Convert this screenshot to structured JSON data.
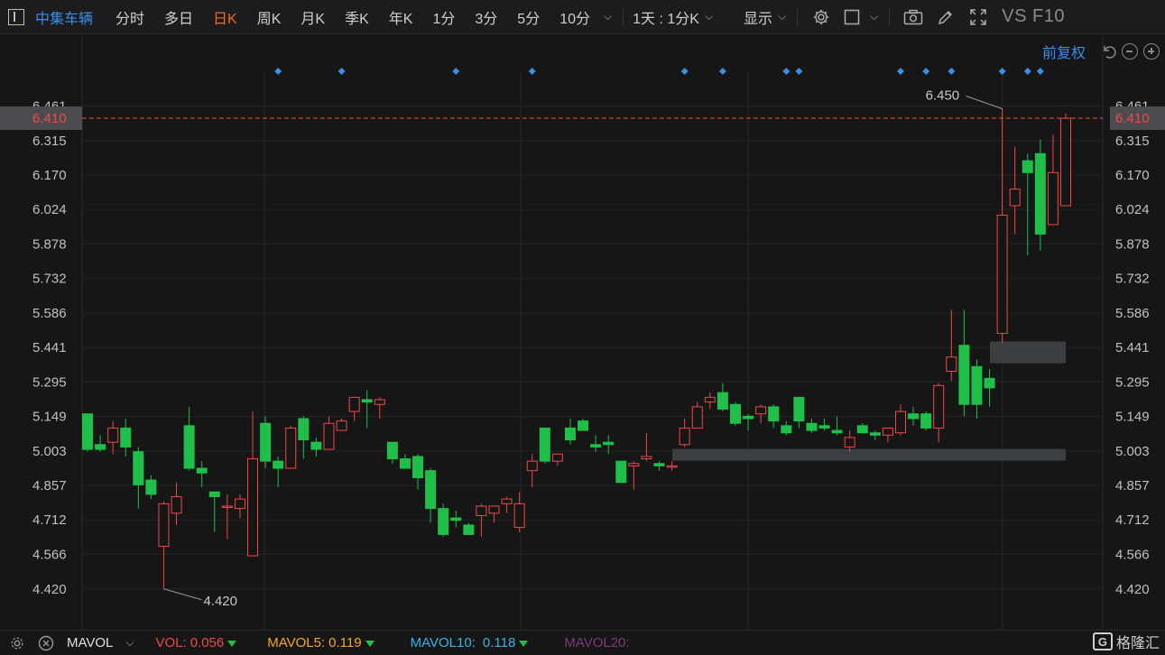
{
  "toolbar": {
    "stock_name": "中集车辆",
    "tabs": [
      {
        "label": "分时",
        "active": false
      },
      {
        "label": "多日",
        "active": false
      },
      {
        "label": "日K",
        "active": true
      },
      {
        "label": "周K",
        "active": false
      },
      {
        "label": "月K",
        "active": false
      },
      {
        "label": "季K",
        "active": false
      },
      {
        "label": "年K",
        "active": false
      },
      {
        "label": "1分",
        "active": false
      },
      {
        "label": "3分",
        "active": false
      },
      {
        "label": "5分",
        "active": false
      },
      {
        "label": "10分",
        "active": false
      }
    ],
    "period_select": "1天 : 1分K",
    "display_label": "显示",
    "vs_f10": "VS F10"
  },
  "chart_header": {
    "adjust_label": "前复权"
  },
  "price_axis": {
    "ticks": [
      "6.461",
      "6.315",
      "6.170",
      "6.024",
      "5.878",
      "5.732",
      "5.586",
      "5.441",
      "5.295",
      "5.149",
      "5.003",
      "4.857",
      "4.712",
      "4.566",
      "4.420"
    ],
    "current_price": "6.410",
    "high_annotation": "6.450",
    "low_annotation": "4.420"
  },
  "indicator_bar": {
    "name": "MAVOL",
    "vol_label": "VOL:",
    "vol_value": "0.056",
    "mavol5_label": "MAVOL5:",
    "mavol5_value": "0.119",
    "mavol10_label": "MAVOL10:",
    "mavol10_value": "0.118",
    "mavol20_label": "MAVOL20:"
  },
  "brand": {
    "name": "格隆汇"
  },
  "colors": {
    "up": "#f04848",
    "down": "#1fbf4a",
    "accent": "#3a8ee6",
    "active_tab": "#f06a2a",
    "vol": "#f04848",
    "mavol5": "#f5a623",
    "mavol10": "#33b5e5",
    "mavol20": "#8e3a8e"
  },
  "chart_data": {
    "type": "candlestick",
    "ylim": [
      4.4,
      6.49
    ],
    "current_price": 6.41,
    "high": 6.45,
    "low": 4.42,
    "event_marker_indices": [
      15,
      20,
      29,
      35,
      47,
      50,
      55,
      56,
      64,
      66,
      68,
      72,
      74,
      75
    ],
    "candles": [
      {
        "o": 5.16,
        "c": 5.01,
        "h": 5.16,
        "l": 5.0
      },
      {
        "o": 5.03,
        "c": 5.01,
        "h": 5.07,
        "l": 5.0
      },
      {
        "o": 5.04,
        "c": 5.1,
        "h": 5.13,
        "l": 4.99
      },
      {
        "o": 5.1,
        "c": 5.02,
        "h": 5.14,
        "l": 4.98
      },
      {
        "o": 5.0,
        "c": 4.86,
        "h": 5.02,
        "l": 4.76
      },
      {
        "o": 4.88,
        "c": 4.82,
        "h": 4.9,
        "l": 4.8
      },
      {
        "o": 4.6,
        "c": 4.78,
        "h": 4.79,
        "l": 4.42
      },
      {
        "o": 4.74,
        "c": 4.81,
        "h": 4.87,
        "l": 4.69
      },
      {
        "o": 5.11,
        "c": 4.93,
        "h": 5.19,
        "l": 4.92
      },
      {
        "o": 4.93,
        "c": 4.91,
        "h": 4.96,
        "l": 4.85
      },
      {
        "o": 4.83,
        "c": 4.81,
        "h": 4.83,
        "l": 4.66
      },
      {
        "o": 4.77,
        "c": 4.77,
        "h": 4.82,
        "l": 4.63
      },
      {
        "o": 4.76,
        "c": 4.8,
        "h": 4.82,
        "l": 4.72
      },
      {
        "o": 4.56,
        "c": 4.97,
        "h": 5.17,
        "l": 4.56
      },
      {
        "o": 5.12,
        "c": 4.96,
        "h": 5.15,
        "l": 4.93
      },
      {
        "o": 4.96,
        "c": 4.93,
        "h": 4.98,
        "l": 4.85
      },
      {
        "o": 4.93,
        "c": 5.1,
        "h": 5.11,
        "l": 4.93
      },
      {
        "o": 5.14,
        "c": 5.05,
        "h": 5.15,
        "l": 4.97
      },
      {
        "o": 5.04,
        "c": 5.01,
        "h": 5.06,
        "l": 4.98
      },
      {
        "o": 5.01,
        "c": 5.12,
        "h": 5.15,
        "l": 5.01
      },
      {
        "o": 5.09,
        "c": 5.13,
        "h": 5.14,
        "l": 5.09
      },
      {
        "o": 5.17,
        "c": 5.23,
        "h": 5.23,
        "l": 5.13
      },
      {
        "o": 5.22,
        "c": 5.21,
        "h": 5.26,
        "l": 5.1
      },
      {
        "o": 5.2,
        "c": 5.22,
        "h": 5.23,
        "l": 5.14
      },
      {
        "o": 5.04,
        "c": 4.97,
        "h": 5.04,
        "l": 4.95
      },
      {
        "o": 4.97,
        "c": 4.93,
        "h": 4.99,
        "l": 4.93
      },
      {
        "o": 4.98,
        "c": 4.89,
        "h": 4.99,
        "l": 4.84
      },
      {
        "o": 4.92,
        "c": 4.76,
        "h": 4.93,
        "l": 4.7
      },
      {
        "o": 4.76,
        "c": 4.65,
        "h": 4.78,
        "l": 4.64
      },
      {
        "o": 4.72,
        "c": 4.71,
        "h": 4.75,
        "l": 4.68
      },
      {
        "o": 4.69,
        "c": 4.65,
        "h": 4.7,
        "l": 4.65
      },
      {
        "o": 4.73,
        "c": 4.77,
        "h": 4.78,
        "l": 4.64
      },
      {
        "o": 4.74,
        "c": 4.77,
        "h": 4.77,
        "l": 4.7
      },
      {
        "o": 4.78,
        "c": 4.8,
        "h": 4.81,
        "l": 4.74
      },
      {
        "o": 4.68,
        "c": 4.78,
        "h": 4.83,
        "l": 4.66
      },
      {
        "o": 4.92,
        "c": 4.96,
        "h": 4.99,
        "l": 4.85
      },
      {
        "o": 5.1,
        "c": 4.96,
        "h": 5.1,
        "l": 4.95
      },
      {
        "o": 4.96,
        "c": 4.99,
        "h": 4.99,
        "l": 4.94
      },
      {
        "o": 5.1,
        "c": 5.05,
        "h": 5.14,
        "l": 5.03
      },
      {
        "o": 5.13,
        "c": 5.09,
        "h": 5.14,
        "l": 5.09
      },
      {
        "o": 5.03,
        "c": 5.02,
        "h": 5.07,
        "l": 5.0
      },
      {
        "o": 5.04,
        "c": 5.03,
        "h": 5.07,
        "l": 4.99
      },
      {
        "o": 4.96,
        "c": 4.87,
        "h": 4.96,
        "l": 4.87
      },
      {
        "o": 4.94,
        "c": 4.95,
        "h": 4.96,
        "l": 4.84
      },
      {
        "o": 4.97,
        "c": 4.98,
        "h": 5.08,
        "l": 4.96
      },
      {
        "o": 4.95,
        "c": 4.94,
        "h": 4.96,
        "l": 4.92
      },
      {
        "o": 4.94,
        "c": 4.94,
        "h": 4.96,
        "l": 4.92
      },
      {
        "o": 5.03,
        "c": 5.1,
        "h": 5.14,
        "l": 5.02
      },
      {
        "o": 5.1,
        "c": 5.19,
        "h": 5.21,
        "l": 5.1
      },
      {
        "o": 5.21,
        "c": 5.23,
        "h": 5.25,
        "l": 5.18
      },
      {
        "o": 5.25,
        "c": 5.18,
        "h": 5.29,
        "l": 5.17
      },
      {
        "o": 5.2,
        "c": 5.12,
        "h": 5.21,
        "l": 5.11
      },
      {
        "o": 5.15,
        "c": 5.14,
        "h": 5.16,
        "l": 5.09
      },
      {
        "o": 5.16,
        "c": 5.19,
        "h": 5.2,
        "l": 5.12
      },
      {
        "o": 5.19,
        "c": 5.13,
        "h": 5.2,
        "l": 5.1
      },
      {
        "o": 5.11,
        "c": 5.08,
        "h": 5.13,
        "l": 5.07
      },
      {
        "o": 5.23,
        "c": 5.13,
        "h": 5.23,
        "l": 5.1
      },
      {
        "o": 5.12,
        "c": 5.09,
        "h": 5.14,
        "l": 5.08
      },
      {
        "o": 5.11,
        "c": 5.1,
        "h": 5.14,
        "l": 5.09
      },
      {
        "o": 5.09,
        "c": 5.08,
        "h": 5.15,
        "l": 5.07
      },
      {
        "o": 5.02,
        "c": 5.06,
        "h": 5.09,
        "l": 5.0
      },
      {
        "o": 5.11,
        "c": 5.08,
        "h": 5.12,
        "l": 5.08
      },
      {
        "o": 5.08,
        "c": 5.07,
        "h": 5.09,
        "l": 5.05
      },
      {
        "o": 5.07,
        "c": 5.1,
        "h": 5.1,
        "l": 5.04
      },
      {
        "o": 5.08,
        "c": 5.17,
        "h": 5.2,
        "l": 5.07
      },
      {
        "o": 5.16,
        "c": 5.14,
        "h": 5.19,
        "l": 5.11
      },
      {
        "o": 5.16,
        "c": 5.1,
        "h": 5.17,
        "l": 5.09
      },
      {
        "o": 5.1,
        "c": 5.28,
        "h": 5.29,
        "l": 5.04
      },
      {
        "o": 5.34,
        "c": 5.4,
        "h": 5.6,
        "l": 5.3
      },
      {
        "o": 5.45,
        "c": 5.2,
        "h": 5.6,
        "l": 5.15
      },
      {
        "o": 5.36,
        "c": 5.2,
        "h": 5.39,
        "l": 5.14
      },
      {
        "o": 5.31,
        "c": 5.27,
        "h": 5.35,
        "l": 5.19
      },
      {
        "o": 5.5,
        "c": 6.0,
        "h": 6.45,
        "l": 5.46
      },
      {
        "o": 6.04,
        "c": 6.11,
        "h": 6.29,
        "l": 5.92
      },
      {
        "o": 6.23,
        "c": 6.18,
        "h": 6.26,
        "l": 5.83
      },
      {
        "o": 6.26,
        "c": 5.92,
        "h": 6.32,
        "l": 5.85
      },
      {
        "o": 5.96,
        "c": 6.18,
        "h": 6.34,
        "l": 5.96
      },
      {
        "o": 6.04,
        "c": 6.41,
        "h": 6.43,
        "l": 6.04
      }
    ]
  }
}
